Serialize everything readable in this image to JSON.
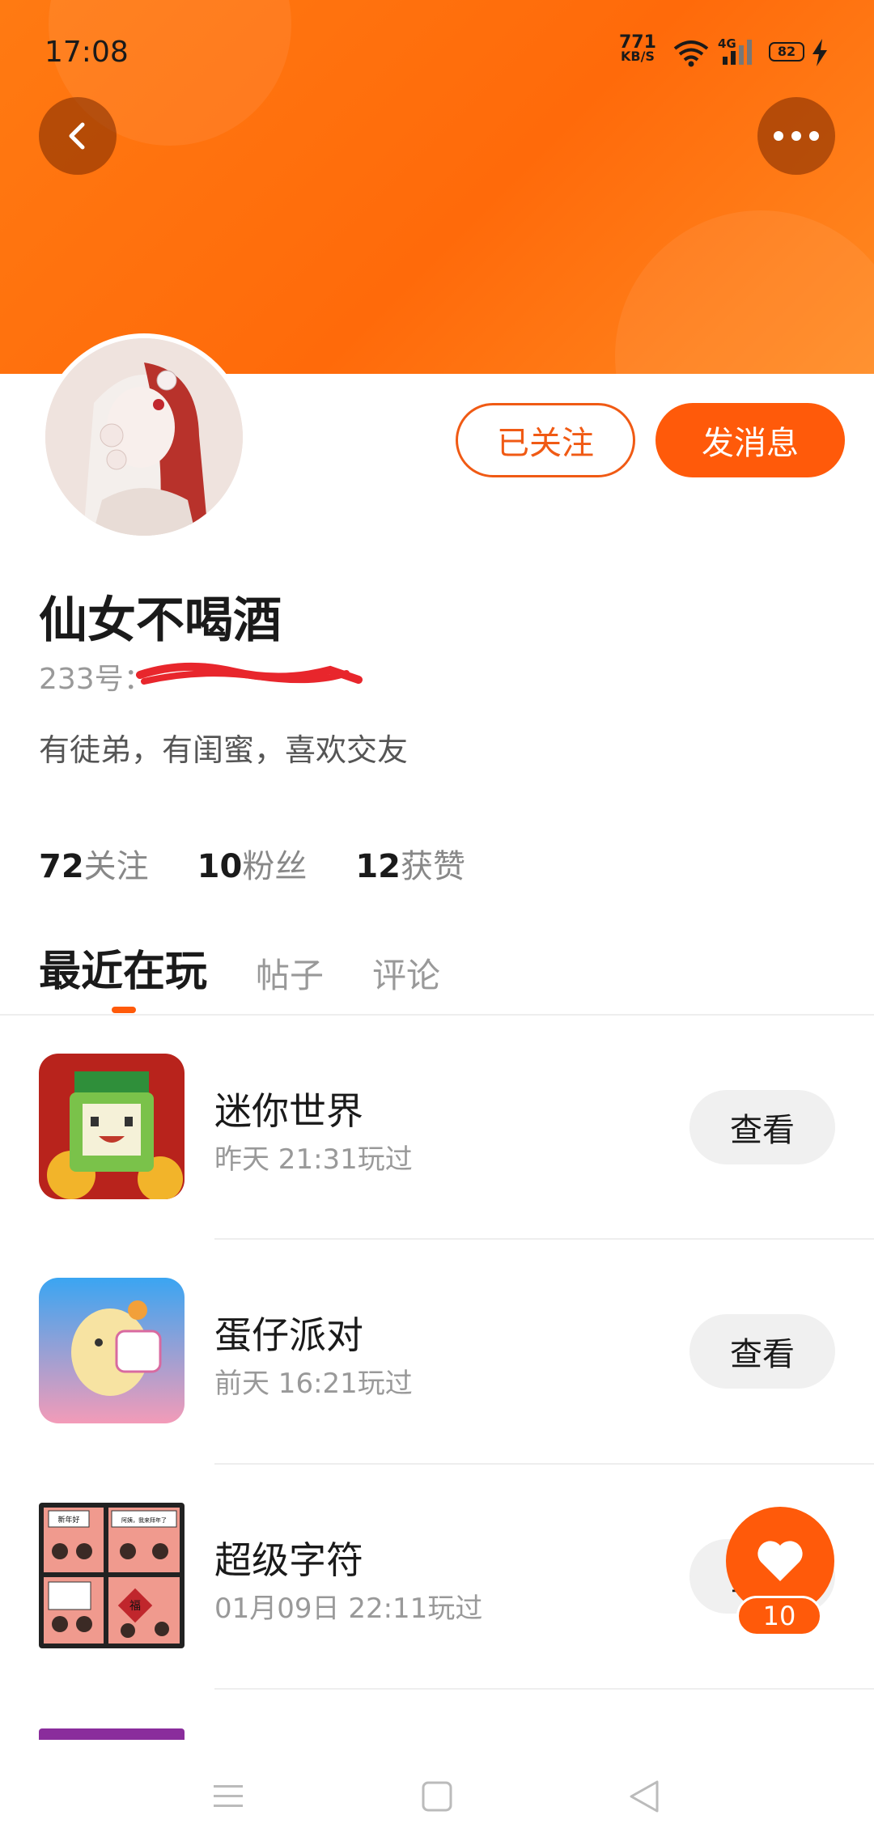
{
  "status_bar": {
    "time": "17:08",
    "net_speed": "771",
    "net_unit": "KB/S",
    "signal_type": "4G",
    "battery": "82"
  },
  "profile": {
    "name": "仙女不喝酒",
    "id_label": "233号：",
    "bio": "有徒弟，有闺蜜，喜欢交友",
    "follow_button": "已关注",
    "message_button": "发消息",
    "stats": [
      {
        "value": "72",
        "label": "关注"
      },
      {
        "value": "10",
        "label": "粉丝"
      },
      {
        "value": "12",
        "label": "获赞"
      }
    ]
  },
  "tabs": [
    {
      "label": "最近在玩",
      "active": true
    },
    {
      "label": "帖子",
      "active": false
    },
    {
      "label": "评论",
      "active": false
    }
  ],
  "games": [
    {
      "name": "迷你世界",
      "last_played": "昨天 21:31玩过",
      "button": "查看"
    },
    {
      "name": "蛋仔派对",
      "last_played": "前天 16:21玩过",
      "button": "查看"
    },
    {
      "name": "超级字符",
      "last_played": "01月09日 22:11玩过",
      "button": "查看"
    }
  ],
  "comic_texts": [
    "新年好",
    "阿姨，我来拜年了",
    "福"
  ],
  "fab": {
    "count": "10"
  },
  "colors": {
    "accent": "#ff5a0a",
    "header": "#ff7a12"
  }
}
